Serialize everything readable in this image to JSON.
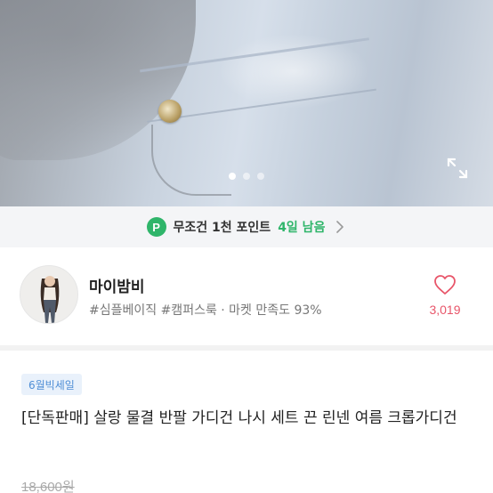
{
  "hero": {
    "slide_count": 3,
    "active_slide": 1,
    "expand_icon": "expand-icon"
  },
  "points_banner": {
    "badge": "P",
    "text": "무조건 1천 포인트",
    "days_left": "4일 남음",
    "accent_color": "#2fb56a"
  },
  "shop": {
    "name": "마이밤비",
    "tags": "#심플베이직 #캠퍼스룩 · 마켓 만족도 93%",
    "likes": "3,019",
    "like_color": "#e8566a"
  },
  "product": {
    "sale_tag": "6월빅세일",
    "title": "[단독판매] 살랑 물결 반팔 가디건 나시 세트 끈 린넨 여름 크롭가디건",
    "original_price": "18,600원"
  }
}
